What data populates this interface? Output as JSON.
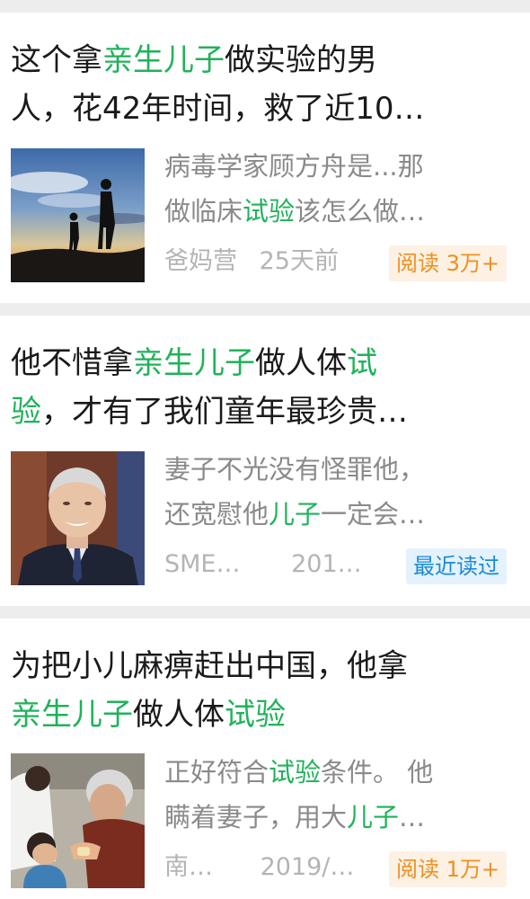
{
  "feed": {
    "items": [
      {
        "title_line1": [
          {
            "t": "这个拿",
            "hl": false
          },
          {
            "t": "亲生儿子",
            "hl": true
          },
          {
            "t": "做实验的男",
            "hl": false
          }
        ],
        "title_line2": [
          {
            "t": "人，花42年时间，救了近10…",
            "hl": false
          }
        ],
        "snippet_line1": [
          {
            "t": "病毒学家顾方舟是...那",
            "hl": false
          }
        ],
        "snippet_line2": [
          {
            "t": "做临床",
            "hl": false
          },
          {
            "t": "试验",
            "hl": true
          },
          {
            "t": "该怎么做…",
            "hl": false
          }
        ],
        "source": "爸妈营",
        "time": "25天前",
        "badge": "阅读 3万+",
        "badge_style": "orange",
        "thumbnail_icon": "silhouette-sunset-photo"
      },
      {
        "title_line1": [
          {
            "t": "他不惜拿",
            "hl": false
          },
          {
            "t": "亲生儿子",
            "hl": true
          },
          {
            "t": "做人体",
            "hl": false
          },
          {
            "t": "试",
            "hl": true
          }
        ],
        "title_line2": [
          {
            "t": "验",
            "hl": true
          },
          {
            "t": "，才有了我们童年最珍贵…",
            "hl": false
          }
        ],
        "snippet_line1": [
          {
            "t": "妻子不光没有怪罪他，",
            "hl": false
          }
        ],
        "snippet_line2": [
          {
            "t": "还宽慰他",
            "hl": false
          },
          {
            "t": "儿子",
            "hl": true
          },
          {
            "t": "一定会…",
            "hl": false
          }
        ],
        "source": "SME…",
        "time": "201…",
        "badge": "最近读过",
        "badge_style": "blue",
        "thumbnail_icon": "elderly-man-portrait-photo"
      },
      {
        "title_line1": [
          {
            "t": "为把小儿麻痹赶出中国，他拿",
            "hl": false
          }
        ],
        "title_line2": [
          {
            "t": "亲生儿子",
            "hl": true
          },
          {
            "t": "做人体",
            "hl": false
          },
          {
            "t": "试验",
            "hl": true
          }
        ],
        "snippet_line1": [
          {
            "t": "正好符合",
            "hl": false
          },
          {
            "t": "试验",
            "hl": true
          },
          {
            "t": "条件。 他",
            "hl": false
          }
        ],
        "snippet_line2": [
          {
            "t": "瞒着妻子，用大",
            "hl": false
          },
          {
            "t": "儿子",
            "hl": true
          },
          {
            "t": "…",
            "hl": false
          }
        ],
        "source": "南…",
        "time": "2019/…",
        "badge": "阅读 1万+",
        "badge_style": "orange",
        "thumbnail_icon": "doctor-feeding-child-photo"
      }
    ]
  },
  "colors": {
    "highlight": "#20b25a",
    "title": "#1a1a1a",
    "snippet": "#8a8a8a",
    "meta": "#b4b4b4",
    "badge_orange_bg": "#fdf1e4",
    "badge_orange_text": "#ef8f21",
    "badge_blue_bg": "#e4f2fd",
    "badge_blue_text": "#1c8ad6",
    "separator": "#ededed"
  }
}
